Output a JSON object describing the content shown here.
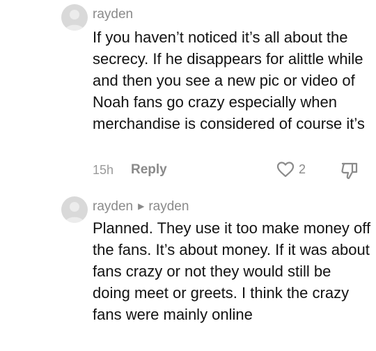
{
  "comments": [
    {
      "username": "rayden",
      "text": "If you haven’t noticed it’s all about the secrecy. If he disappears for alittle while and then you see a new pic or video of Noah fans go crazy especially when merchandise is considered of course it’s",
      "time": "15h",
      "reply_label": "Reply",
      "like_count": "2"
    },
    {
      "username": "rayden",
      "reply_to": "rayden",
      "text": "Planned. They use it too make money off the fans. It’s about money. If it was about fans crazy or not they would still be doing meet or greets. I think the crazy fans were mainly online"
    }
  ],
  "icons": {
    "avatar": "default-avatar-icon",
    "like": "heart-outline-icon",
    "dislike": "thumbs-down-icon",
    "reply_arrow": "caret-right-icon"
  },
  "colors": {
    "text": "#121212",
    "muted": "#8a8a8a",
    "avatar_bg": "#d9d9d9"
  }
}
